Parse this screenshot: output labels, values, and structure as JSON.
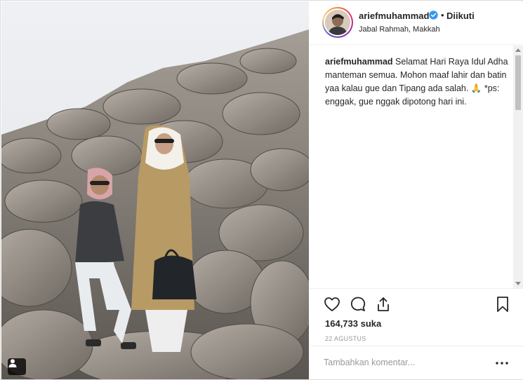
{
  "post": {
    "author": {
      "username": "ariefmuhammad",
      "verified_icon": "verified-badge-icon",
      "separator": "•",
      "follow_state": "Diikuti",
      "location": "Jabal Rahmah, Makkah"
    },
    "caption": {
      "username": "ariefmuhammad",
      "text": " Selamat Hari Raya Idul Adha manteman semua. Mohon maaf lahir dan batin yaa kalau gue dan Tipang ada salah. 🙏 *ps: enggak, gue nggak dipotong hari ini."
    },
    "actions": {
      "like_icon": "heart-icon",
      "comment_icon": "comment-bubble-icon",
      "share_icon": "share-icon",
      "save_icon": "bookmark-icon"
    },
    "likes_label": "164,733 suka",
    "date": "22 AGUSTUS",
    "comment_box": {
      "placeholder": "Tambahkan komentar...",
      "more_icon": "more-options-icon"
    },
    "photo": {
      "tag_icon": "tagged-user-icon"
    }
  },
  "colors": {
    "verified": "#3897f0",
    "text": "#262626",
    "muted": "#999999",
    "border": "#efefef"
  }
}
